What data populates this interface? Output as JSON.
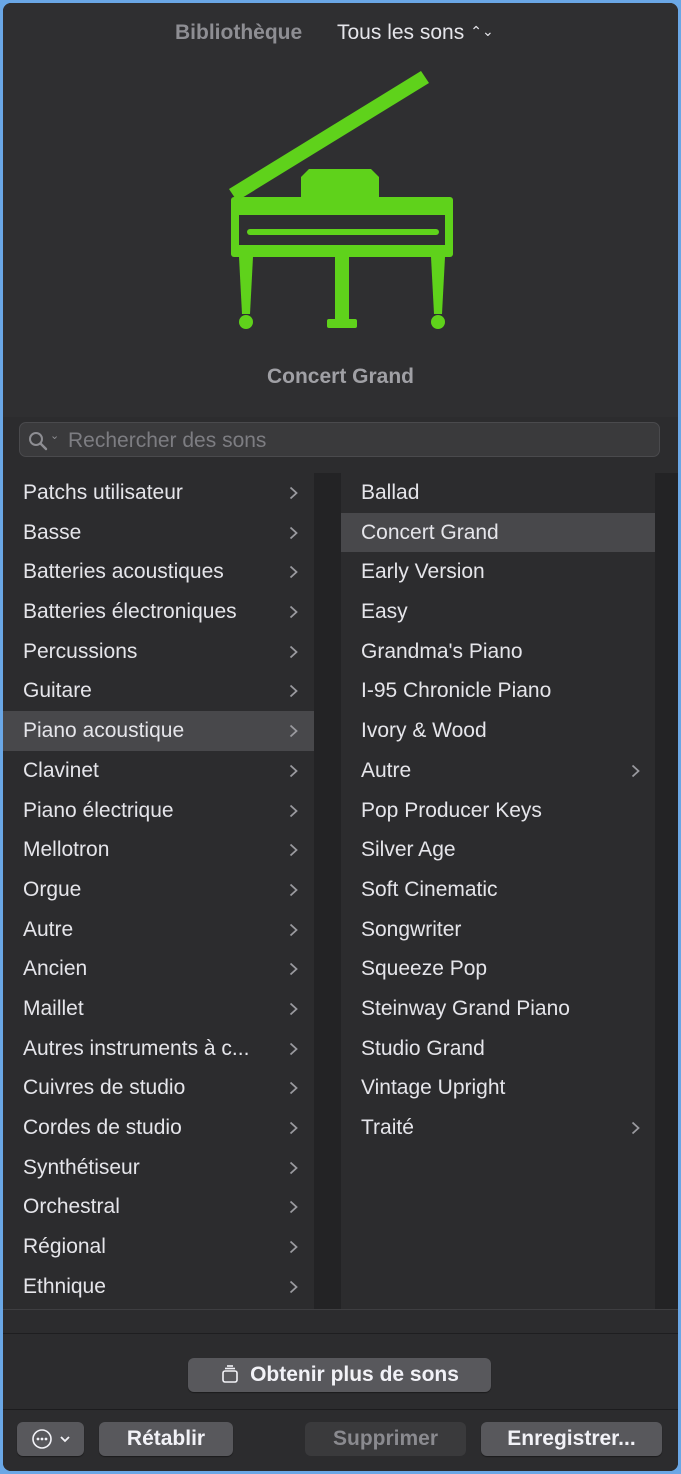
{
  "header": {
    "library_label": "Bibliothèque",
    "sound_filter": "Tous les sons",
    "preset_name": "Concert Grand",
    "icon_color": "#5fd21b"
  },
  "search": {
    "placeholder": "Rechercher des sons"
  },
  "categories": [
    "Patchs utilisateur",
    "Basse",
    "Batteries acoustiques",
    "Batteries électroniques",
    "Percussions",
    "Guitare",
    "Piano acoustique",
    "Clavinet",
    "Piano électrique",
    "Mellotron",
    "Orgue",
    "Autre",
    "Ancien",
    "Maillet",
    "Autres instruments à c...",
    "Cuivres de studio",
    "Cordes de studio",
    "Synthétiseur",
    "Orchestral",
    "Régional",
    "Ethnique"
  ],
  "selected_category": "Piano acoustique",
  "presets": [
    "Ballad",
    "Concert Grand",
    "Early Version",
    "Easy",
    "Grandma's Piano",
    "I-95 Chronicle Piano",
    "Ivory & Wood",
    "Autre",
    "Pop Producer Keys",
    "Silver Age",
    "Soft Cinematic",
    "Songwriter",
    "Squeeze Pop",
    "Steinway Grand Piano",
    "Studio Grand",
    "Vintage Upright",
    "Traité"
  ],
  "selected_preset": "Concert Grand",
  "preset_folders": [
    "Autre",
    "Traité"
  ],
  "buttons": {
    "get_more": "Obtenir plus de sons",
    "revert": "Rétablir",
    "delete": "Supprimer",
    "save": "Enregistrer..."
  }
}
